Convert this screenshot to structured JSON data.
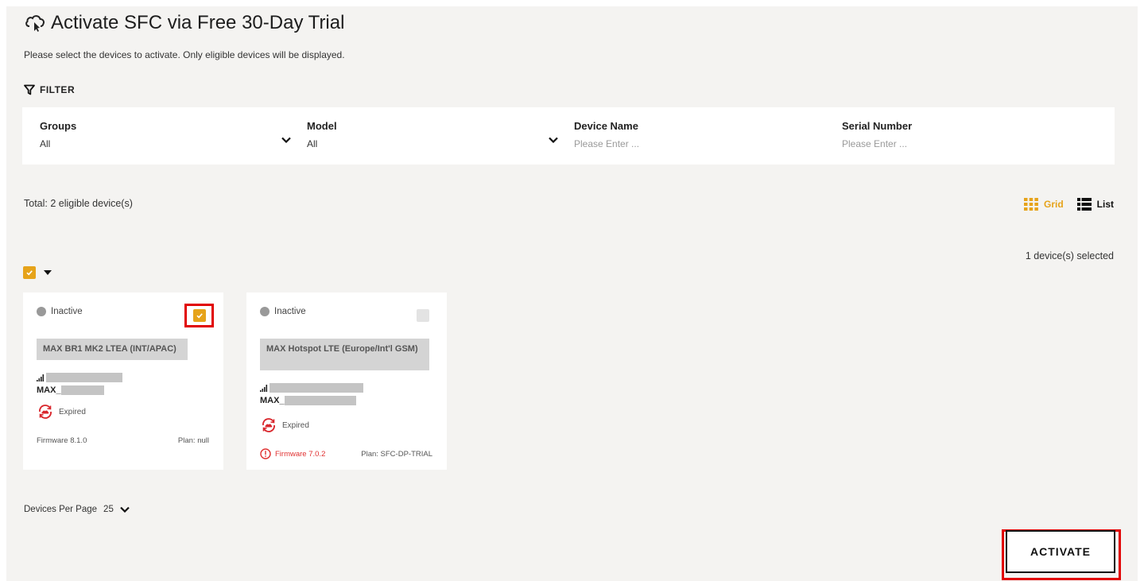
{
  "page": {
    "title": "Activate SFC via Free 30-Day Trial",
    "subtitle": "Please select the devices to activate. Only eligible devices will be displayed."
  },
  "filter": {
    "label": "FILTER",
    "groups": {
      "label": "Groups",
      "value": "All"
    },
    "model": {
      "label": "Model",
      "value": "All"
    },
    "device_name": {
      "label": "Device Name",
      "placeholder": "Please Enter ..."
    },
    "serial_number": {
      "label": "Serial Number",
      "placeholder": "Please Enter ..."
    }
  },
  "summary": {
    "total": "Total: 2 eligible device(s)",
    "selected": "1 device(s) selected"
  },
  "view": {
    "grid_label": "Grid",
    "list_label": "List",
    "active": "grid"
  },
  "devices": [
    {
      "status": "Inactive",
      "checked": true,
      "model": "MAX BR1 MK2 LTEA (INT/APAC)",
      "name_prefix": "MAX_",
      "subscription": "Expired",
      "firmware": "Firmware 8.1.0",
      "firmware_warning": false,
      "plan": "Plan: null"
    },
    {
      "status": "Inactive",
      "checked": false,
      "model": "MAX Hotspot LTE (Europe/Int'l GSM)",
      "name_prefix": "MAX_",
      "subscription": "Expired",
      "firmware": "Firmware 7.0.2",
      "firmware_warning": true,
      "plan": "Plan: SFC-DP-TRIAL"
    }
  ],
  "pagination": {
    "label": "Devices Per Page",
    "value": "25"
  },
  "actions": {
    "activate_label": "ACTIVATE"
  },
  "colors": {
    "accent": "#e6a31a",
    "highlight": "#e10000",
    "warning": "#e03030",
    "background": "#f4f3f1"
  }
}
